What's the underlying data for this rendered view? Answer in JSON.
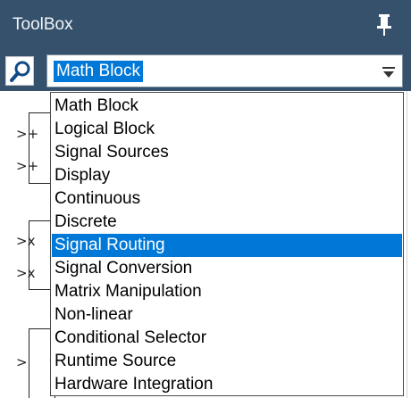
{
  "window": {
    "title": "ToolBox",
    "pin_icon": "pin-icon"
  },
  "search": {
    "icon": "search-icon",
    "selected_value": "Math Block",
    "arrow_icon": "chevron-down-icon"
  },
  "dropdown": {
    "items": [
      {
        "label": "Math Block"
      },
      {
        "label": "Logical Block"
      },
      {
        "label": "Signal Sources"
      },
      {
        "label": "Display"
      },
      {
        "label": "Continuous"
      },
      {
        "label": "Discrete"
      },
      {
        "label": "Signal Routing",
        "highlighted": true
      },
      {
        "label": "Signal Conversion"
      },
      {
        "label": "Matrix Manipulation"
      },
      {
        "label": "Non-linear"
      },
      {
        "label": "Conditional Selector"
      },
      {
        "label": "Runtime Source"
      },
      {
        "label": "Hardware Integration"
      }
    ]
  },
  "background_blocks": {
    "symbols": [
      ">+",
      ">+",
      ">x",
      ">x",
      ">"
    ]
  },
  "colors": {
    "titlebar": "#36516c",
    "selection": "#0078d7"
  }
}
